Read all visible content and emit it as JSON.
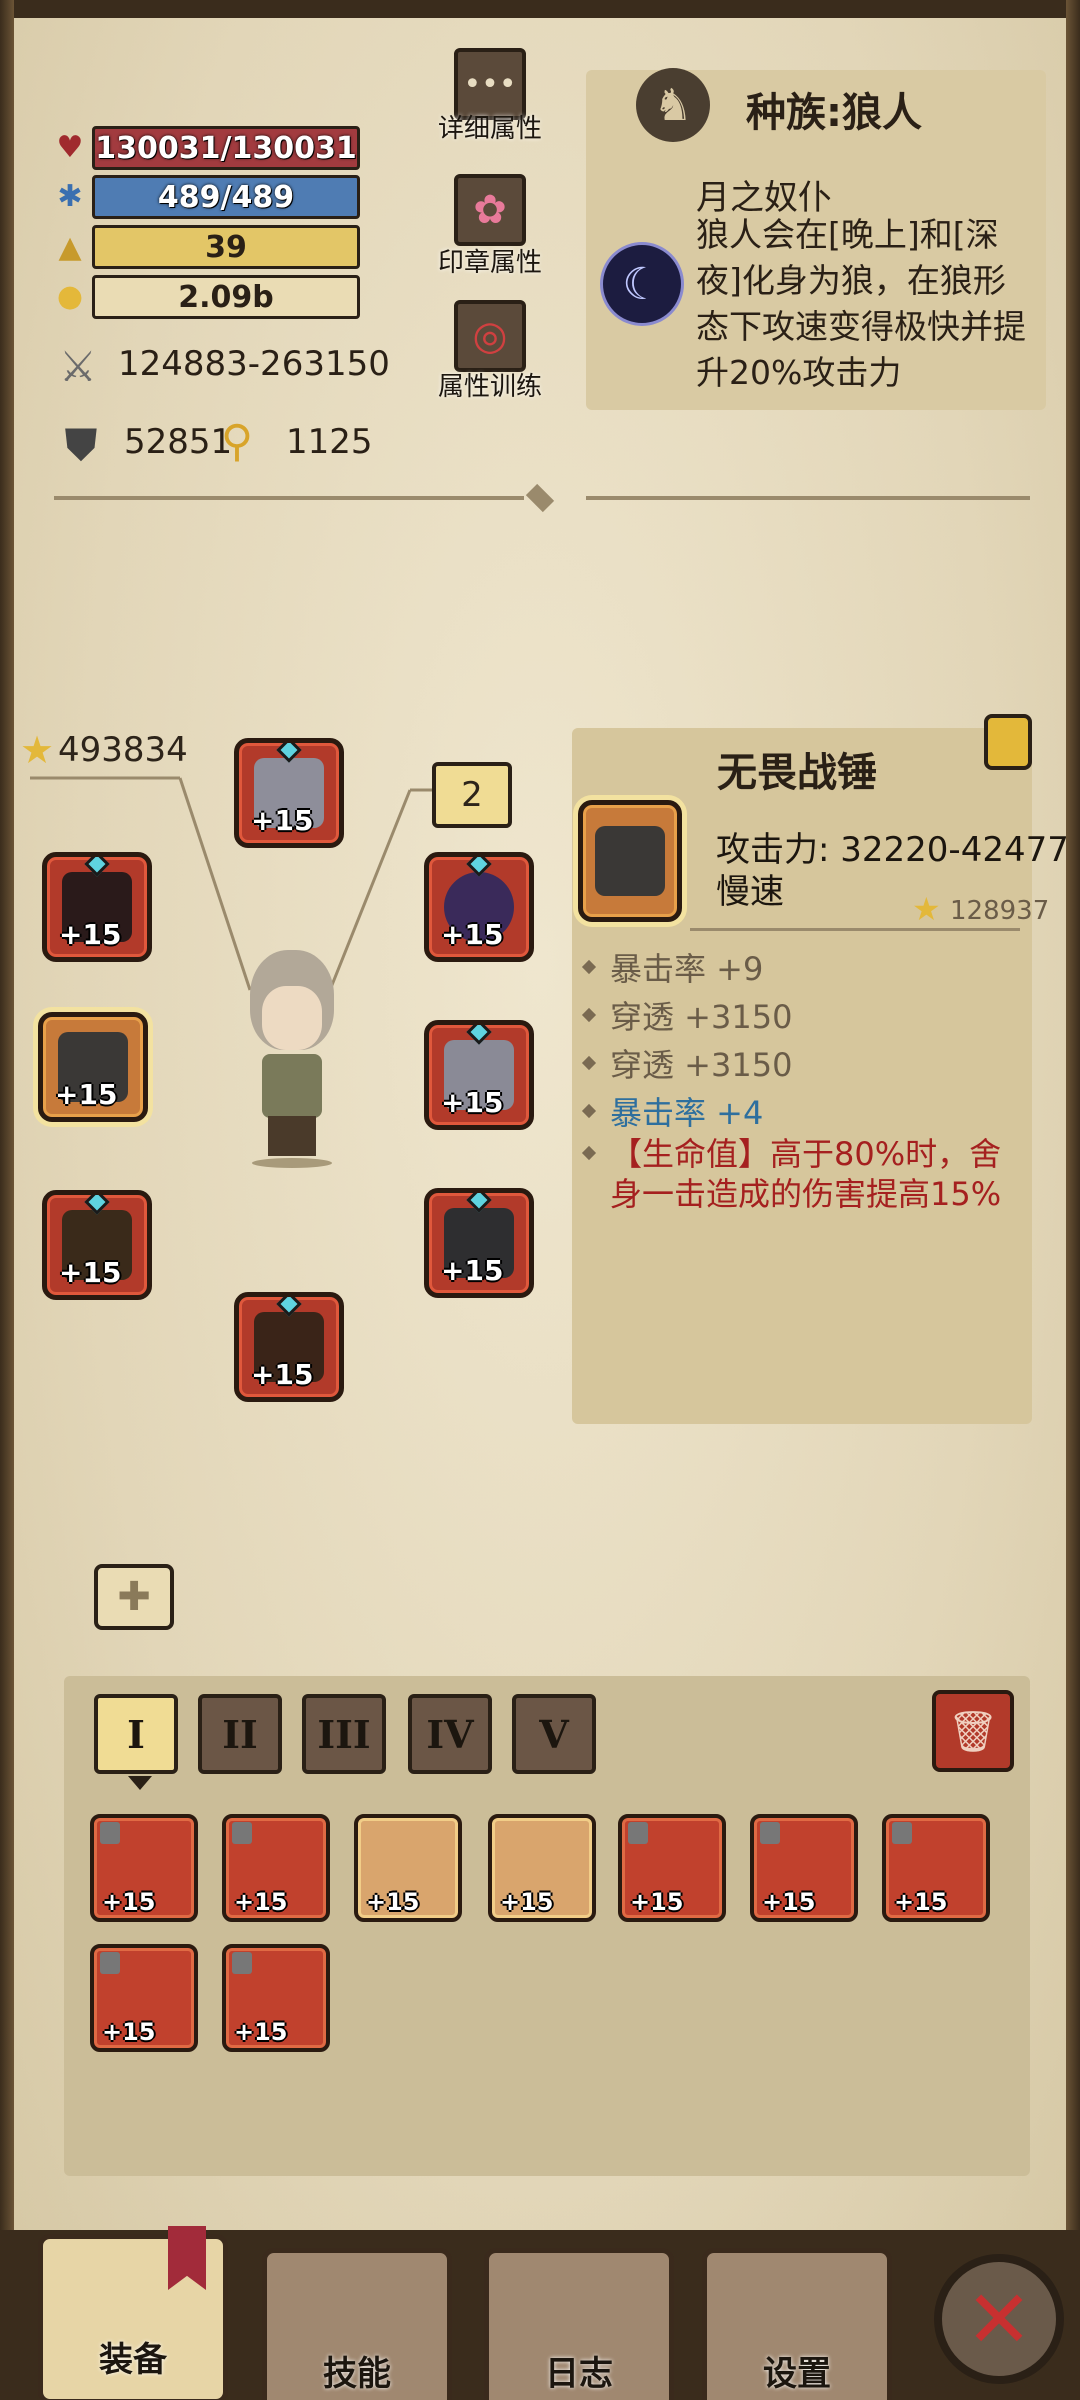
{
  "stats": {
    "hp": "130031/130031",
    "mp": "489/489",
    "level": "39",
    "gold": "2.09b",
    "attack": "124883-263150",
    "defense": "52851",
    "power": "1125"
  },
  "side_buttons": {
    "detail": "详细属性",
    "seal": "印章属性",
    "training": "属性训练"
  },
  "race": {
    "title": "种族:狼人",
    "name": "月之奴仆",
    "description": "狼人会在[晚上]和[深夜]化身为狼，在狼形态下攻速变得极快并提升20%攻击力"
  },
  "equipment": {
    "total_score": "493834",
    "slot_count_badge": "2",
    "slots": [
      {
        "key": "helmet",
        "level": "+15"
      },
      {
        "key": "left1",
        "level": "+15"
      },
      {
        "key": "left2",
        "level": "+15"
      },
      {
        "key": "left3",
        "level": "+15"
      },
      {
        "key": "right1",
        "level": "+15"
      },
      {
        "key": "right2",
        "level": "+15"
      },
      {
        "key": "right3",
        "level": "+15"
      },
      {
        "key": "bottom",
        "level": "+15"
      }
    ]
  },
  "item_detail": {
    "name": "无畏战锤",
    "attack": "攻击力: 32220-42477",
    "speed": "慢速",
    "score": "128937",
    "lines": [
      {
        "text": "暴击率 +9",
        "style": "gray"
      },
      {
        "text": "穿透 +3150",
        "style": "gray"
      },
      {
        "text": "穿透 +3150",
        "style": "gray"
      },
      {
        "text": "暴击率 +4",
        "style": "blue"
      },
      {
        "text": "【生命值】高于80%时，舍身一击造成的伤害提高15%",
        "style": "red"
      }
    ]
  },
  "inventory": {
    "tabs": [
      "I",
      "II",
      "III",
      "IV",
      "V"
    ],
    "active_tab": "I",
    "items": [
      "+15",
      "+15",
      "+15",
      "+15",
      "+15",
      "+15",
      "+15",
      "+15",
      "+15"
    ]
  },
  "nav": {
    "equip": "装备",
    "skills": "技能",
    "log": "日志",
    "settings": "设置"
  }
}
